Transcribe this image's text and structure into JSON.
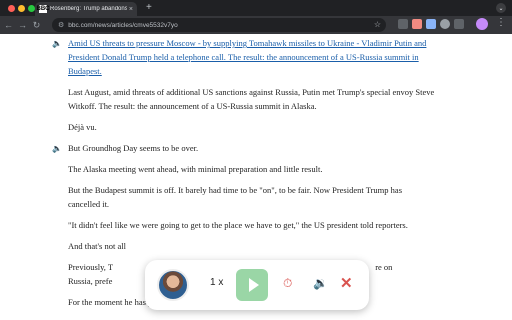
{
  "browser": {
    "tab_title": "Rosenberg: Trump abandons",
    "tab_favicon": "BBC",
    "url": "bbc.com/news/articles/cmve5532v7yo"
  },
  "article": {
    "link_paragraph": "Amid US threats to pressure Moscow - by supplying Tomahawk missiles to Ukraine - Vladimir Putin and President Donald Trump held a telephone call. The result: the announcement of a US-Russia summit in Budapest.",
    "p1": "Last August, amid threats of additional US sanctions against Russia, Putin met Trump's special envoy Steve Witkoff. The result: the announcement of a US-Russia summit in Alaska.",
    "p2": "Déjà vu.",
    "p3": "But Groundhog Day seems to be over.",
    "p4": "The Alaska meeting went ahead, with minimal preparation and little result.",
    "p5": "But the Budapest summit is off. It barely had time to be \"on\", to be fair. Now President Trump has cancelled it.",
    "p6": "\"It didn't feel like we were going to get to the place we have to get,\" the US president told reporters.",
    "p7": "And that's not all",
    "p8_start": "Previously, T",
    "p8_end": "re on",
    "p8_line2_start": "Russia, prefe",
    "p9": "For the moment he has put his carrots away."
  },
  "player": {
    "speed": "1 x"
  },
  "colors": {
    "link": "#1a5ea9",
    "play_button": "#9ad6a6",
    "stop_red": "#d9534f"
  }
}
